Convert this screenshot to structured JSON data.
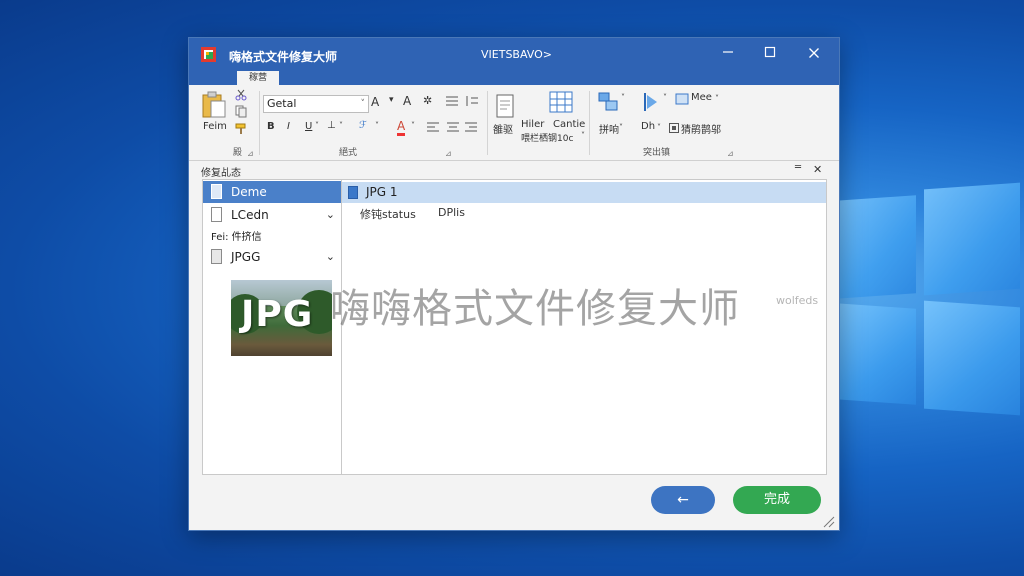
{
  "window": {
    "app_title": "嗨格式文件修复大师",
    "center_title": "VIETSBAVO>",
    "tab_label": "稼营",
    "colors": {
      "titlebar": "#2f63b4",
      "accent": "#4a80c9",
      "done": "#33a852",
      "back": "#3d74c2"
    }
  },
  "ribbon": {
    "paste_label": "Feim",
    "group1_label": "殿",
    "font_name": "Getal",
    "font_group_label": "絕式",
    "size_up": "A",
    "size_down": "A",
    "clear": "A",
    "bold": "B",
    "italic": "I",
    "underline": "U",
    "fx_label": "ℱ",
    "editor_label": "雒驱",
    "hiler_label": "Hiler",
    "cantie_label": "Cantie",
    "mid_label": "喂栏栖钢10c",
    "mee_label": "Mee",
    "text_a": "拼响",
    "text_b": "Dh",
    "text_c": "猜鹃鹊邬",
    "group3_label": "突出镇"
  },
  "panel": {
    "title": "修复乩态",
    "pin": "═",
    "close": "✕"
  },
  "nav": {
    "items": [
      {
        "label": "Deme"
      },
      {
        "label": "LCedn"
      },
      {
        "label": "JPGG"
      }
    ],
    "sub_label": "Fei: 件挤信"
  },
  "thumbnail": {
    "text": "JPG"
  },
  "content": {
    "file_name": "JPG 1",
    "col_status": "修钝status",
    "col_dpi": "DPlis"
  },
  "watermark": {
    "text": "嗨嗨格式文件修复大师",
    "small": "wolfeds"
  },
  "footer": {
    "back_label": "←",
    "done_label": "完成"
  }
}
